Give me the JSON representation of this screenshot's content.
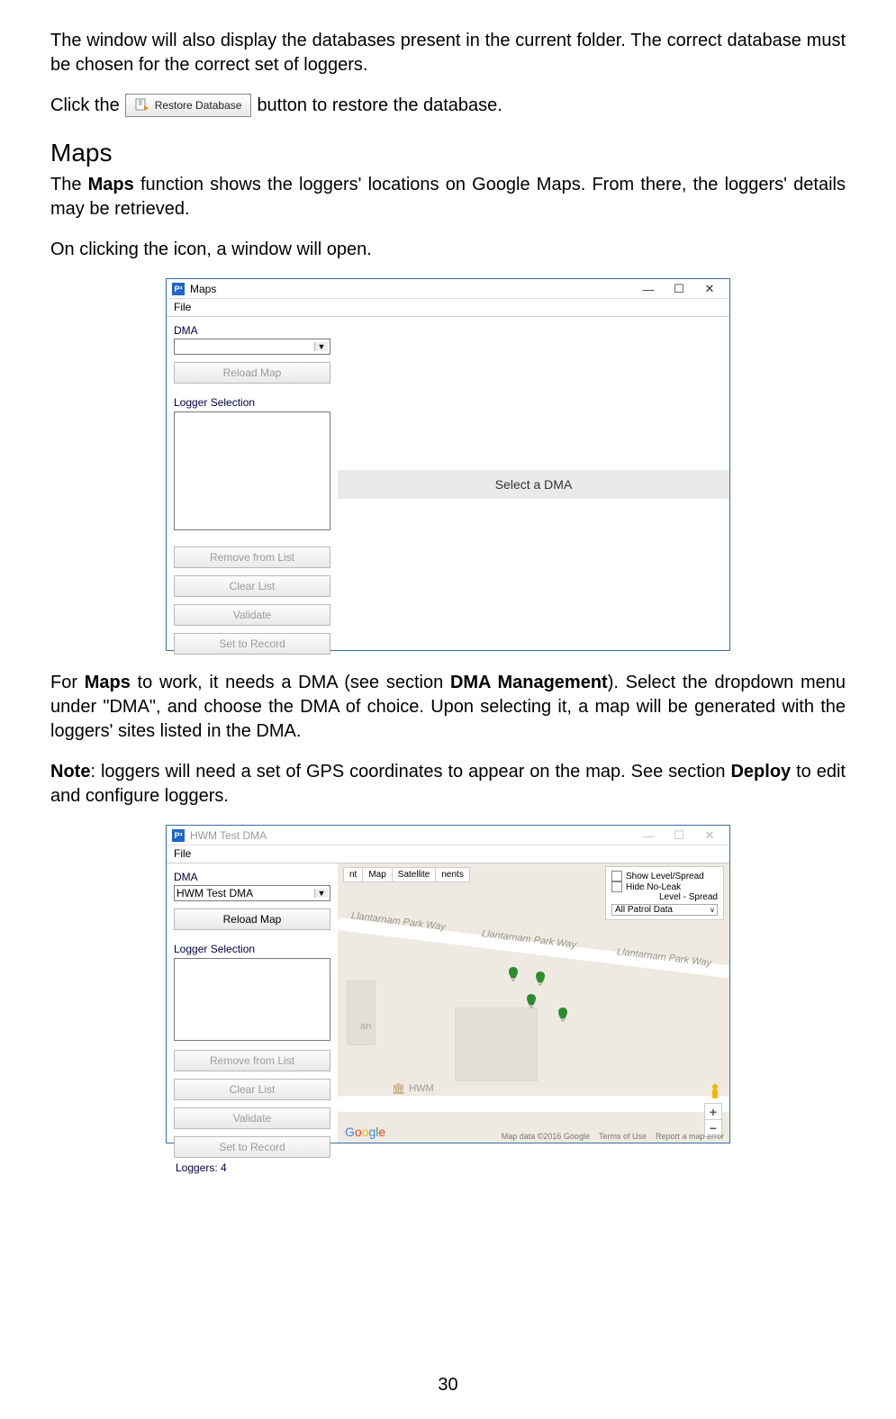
{
  "para1": "The window will also display the databases present in the current folder. The correct database must be chosen for the correct set of loggers.",
  "click_the": "Click the",
  "restore_button_label": "Restore Database",
  "restore_tail": " button to restore the database.",
  "maps_heading": "Maps",
  "maps_para": "The Maps function shows the loggers' locations on Google Maps. From there, the loggers' details may be retrieved.",
  "on_click_para": "On clicking the icon, a window will open.",
  "win1": {
    "title": "Maps",
    "file_menu": "File",
    "dma_label": "DMA",
    "dma_value": "",
    "reload_map": "Reload Map",
    "logger_selection": "Logger Selection",
    "remove": "Remove from List",
    "clear": "Clear List",
    "validate": "Validate",
    "set_record": "Set to Record",
    "select_dma": "Select a DMA"
  },
  "para_needs_dma_pre": "For ",
  "para_needs_dma_maps": "Maps",
  "para_needs_dma_mid1": " to work, it needs a DMA (see section ",
  "para_needs_dma_bold2": "DMA Management",
  "para_needs_dma_tail": "). Select the dropdown menu under \"DMA\", and choose the DMA of choice. Upon selecting it, a map will be generated with the loggers' sites listed in the DMA.",
  "note_label": "Note",
  "note_body_pre": ": loggers will need a set of GPS coordinates to appear on the map. See section ",
  "note_bold": "Deploy",
  "note_body_tail": " to edit and configure loggers.",
  "win2": {
    "title": "HWM Test DMA",
    "file_menu": "File",
    "dma_label": "DMA",
    "dma_value": "HWM Test DMA",
    "reload_map": "Reload Map",
    "logger_selection": "Logger Selection",
    "remove": "Remove from List",
    "clear": "Clear List",
    "validate": "Validate",
    "set_record": "Set to Record",
    "loggers_status": "Loggers: 4",
    "map_tab": "Map",
    "sat_tab": "Satellite",
    "show_level": "Show Level/Spread",
    "hide_noleak": "Hide No-Leak",
    "level_spread": "Level - Spread",
    "all_patrol": "All Patrol Data",
    "road_label": "Llantarnam Park Way",
    "hwm_label": "HWM",
    "attr_data": "Map data ©2016 Google",
    "attr_terms": "Terms of Use",
    "attr_report": "Report a map error"
  },
  "page_number": "30"
}
